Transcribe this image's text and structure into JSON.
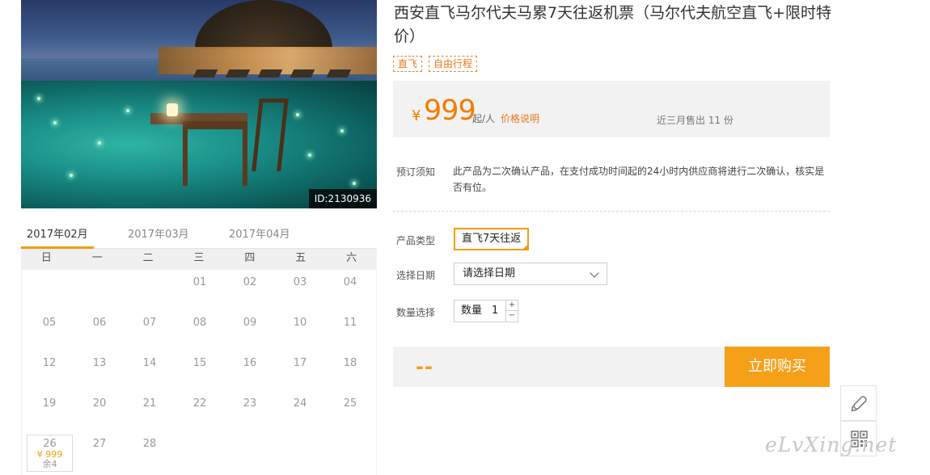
{
  "hero": {
    "image_id": "ID:2130936"
  },
  "calendar": {
    "tabs": [
      "2017年02月",
      "2017年03月",
      "2017年04月"
    ],
    "weekdays": [
      "日",
      "一",
      "二",
      "三",
      "四",
      "五",
      "六"
    ],
    "days": [
      [
        "",
        "",
        "",
        "01",
        "02",
        "03",
        "04"
      ],
      [
        "05",
        "06",
        "07",
        "08",
        "09",
        "10",
        "11"
      ],
      [
        "12",
        "13",
        "14",
        "15",
        "16",
        "17",
        "18"
      ],
      [
        "19",
        "20",
        "21",
        "22",
        "23",
        "24",
        "25"
      ],
      [
        "26",
        "27",
        "28",
        "",
        "",
        "",
        ""
      ]
    ],
    "priced_day": {
      "day": "26",
      "price": "¥ 999",
      "stock": "余4"
    }
  },
  "product": {
    "title": "西安直飞马尔代夫马累7天往返机票（马尔代夫航空直飞+限时特价）",
    "tags": [
      "直飞",
      "自由行程"
    ],
    "price": {
      "currency": "¥",
      "amount": "999",
      "unit": "起/人",
      "explain_link": "价格说明",
      "sold": "近三月售出 11 份"
    },
    "notice": {
      "label": "预订须知",
      "text": "此产品为二次确认产品，在支付成功时间起的24小时内供应商将进行二次确认，核实是否有位。"
    },
    "type": {
      "label": "产品类型",
      "value": "直飞7天往返"
    },
    "date": {
      "label": "选择日期",
      "value": "请选择日期"
    },
    "quantity": {
      "label": "数量选择",
      "prefix": "数量",
      "value": "1",
      "plus": "+",
      "minus": "−"
    },
    "total": "--",
    "buy_button": "立即购买"
  },
  "watermark": "eLvXing.net"
}
